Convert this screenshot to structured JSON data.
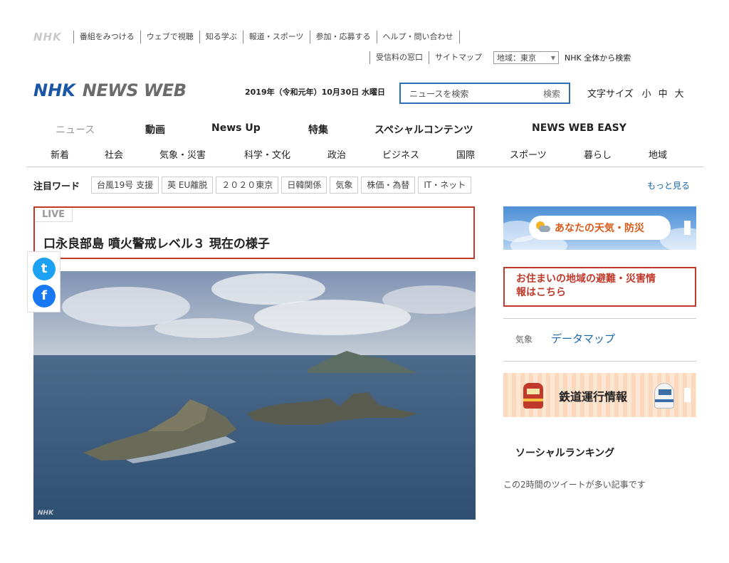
{
  "utility": {
    "brand": "NHK",
    "links": [
      "番組をみつける",
      "ウェブで視聴",
      "知る学ぶ",
      "報道・スポーツ",
      "参加・応募する",
      "ヘルプ・問い合わせ"
    ],
    "row2": {
      "fee": "受信料の窓口",
      "sitemap": "サイトマップ",
      "region_value": "地域：東京",
      "global_search": "NHK 全体から検索"
    }
  },
  "masthead": {
    "logo_nhk": "NHK",
    "logo_news": "NEWS WEB",
    "date": "2019年（令和元年）10月30日 水曜日",
    "search_placeholder": "ニュースを検索",
    "search_button": "検索",
    "fontsize_label": "文字サイズ",
    "fontsize_small": "小",
    "fontsize_medium": "中",
    "fontsize_large": "大"
  },
  "main_nav": [
    "ニュース",
    "動画",
    "News Up",
    "特集",
    "スペシャルコンテンツ",
    "NEWS WEB EASY"
  ],
  "sub_nav": [
    "新着",
    "社会",
    "気象・災害",
    "科学・文化",
    "政治",
    "ビジネス",
    "国際",
    "スポーツ",
    "暮らし",
    "地域"
  ],
  "keywords": {
    "label": "注目ワード",
    "items": [
      "台風19号 支援",
      "英 EU離脱",
      "２０２０東京",
      "日韓関係",
      "気象",
      "株価・為替",
      "IT・ネット"
    ],
    "more": "もっと見る"
  },
  "lead": {
    "live": "LIVE",
    "title": "口永良部島 噴火警戒レベル３ 現在の様子",
    "photo_credit": "NHK"
  },
  "share": {
    "twitter": "t",
    "facebook": "f"
  },
  "sidebar": {
    "weather": "あなたの天気・防災",
    "evac_line1": "お住まいの地域の避難・災害情",
    "evac_line2": "報はこちら",
    "datamap_label": "気象",
    "datamap_link": "データマップ",
    "train": "鉄道運行情報",
    "ranking_title": "ソーシャルランキング",
    "ranking_sub": "この2時間のツイートが多い記事です"
  },
  "colors": {
    "brand_blue": "#1a56a6",
    "alert_red": "#c0392b",
    "link_blue": "#1a68a8"
  }
}
